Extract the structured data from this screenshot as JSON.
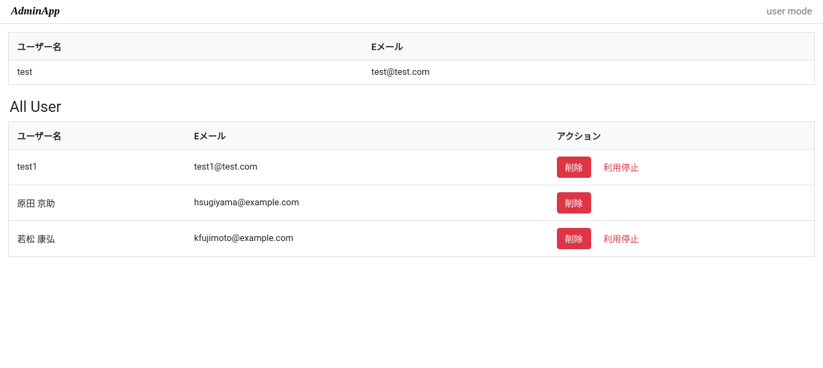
{
  "navbar": {
    "brand": "AdminApp",
    "user_mode_link": "user mode"
  },
  "current_user_table": {
    "headers": {
      "username": "ユーザー名",
      "email": "Eメール"
    },
    "row": {
      "username": "test",
      "email": "test@test.com"
    }
  },
  "all_user_section": {
    "title": "All User",
    "headers": {
      "username": "ユーザー名",
      "email": "Eメール",
      "action": "アクション"
    },
    "rows": [
      {
        "username": "test1",
        "email": "test1@test.com",
        "delete_label": "削除",
        "suspend_label": "利用停止",
        "has_suspend": true
      },
      {
        "username": "原田 京助",
        "email": "hsugiyama@example.com",
        "delete_label": "削除",
        "has_suspend": false
      },
      {
        "username": "若松 康弘",
        "email": "kfujimoto@example.com",
        "delete_label": "削除",
        "suspend_label": "利用停止",
        "has_suspend": true
      }
    ]
  }
}
